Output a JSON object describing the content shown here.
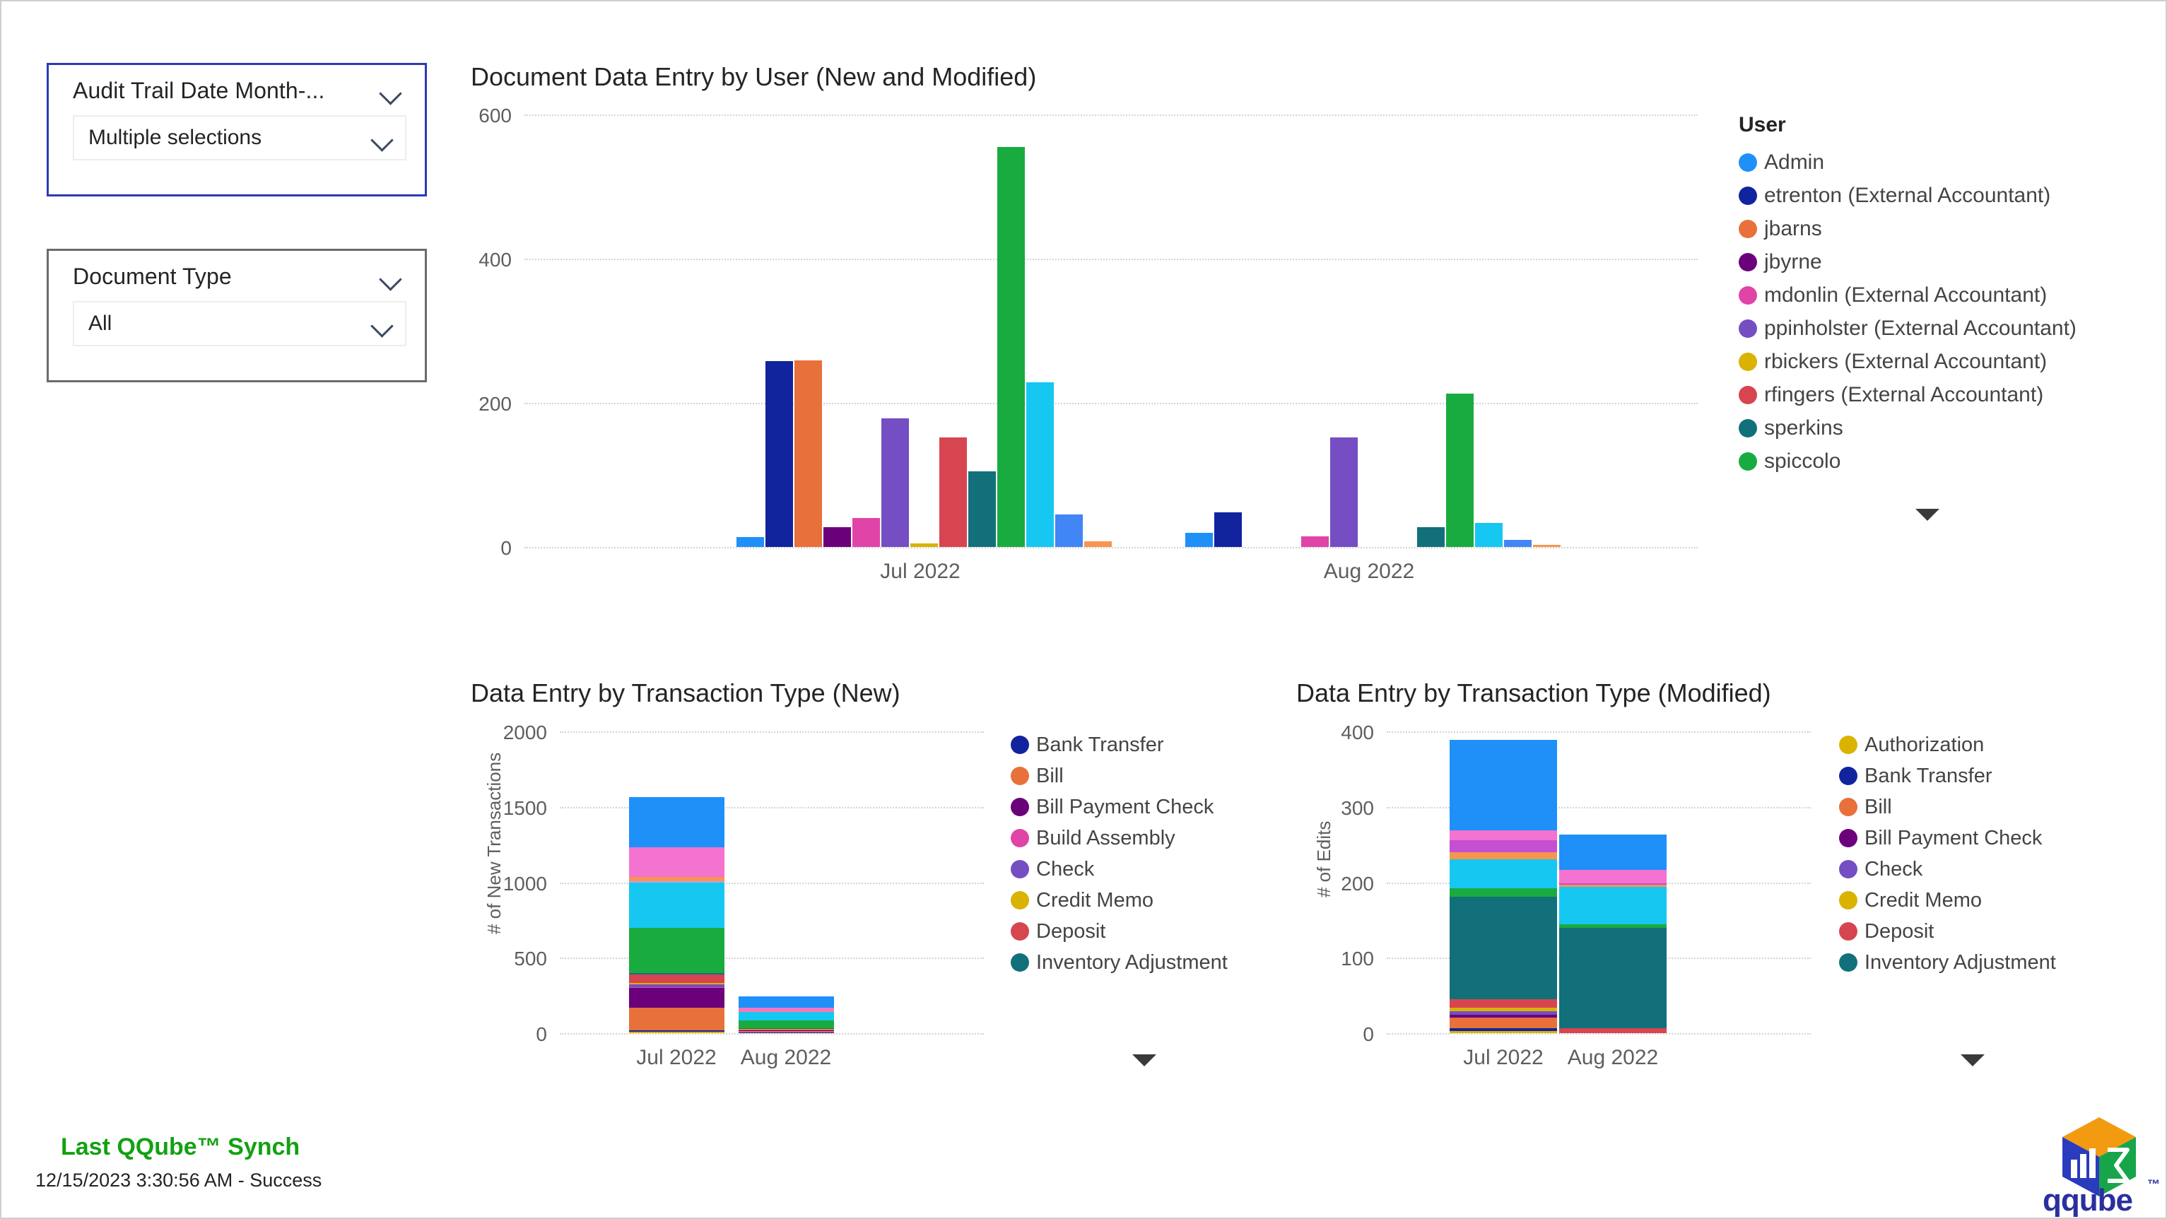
{
  "slicers": [
    {
      "title": "Audit Trail Date Month-...",
      "value": "Multiple selections",
      "chevron": "chevron-down-icon"
    },
    {
      "title": "Document Type",
      "value": "All",
      "chevron": "chevron-down-icon"
    }
  ],
  "footer": {
    "synch_title": "Last QQube™ Synch",
    "synch_status": "12/15/2023 3:30:56 AM - Success",
    "logo_word": "qqube",
    "logo_tm": "™"
  },
  "chart_data": [
    {
      "id": "document-data-entry-by-user",
      "type": "bar",
      "title": "Document Data Entry by User (New and Modified)",
      "xlabel": "",
      "ylabel": "",
      "ylim": [
        0,
        600
      ],
      "yticks": [
        0,
        200,
        400,
        600
      ],
      "grid": true,
      "legend_position": "right",
      "legend_title": "User",
      "categories": [
        "Jul 2022",
        "Aug 2022"
      ],
      "series": [
        {
          "name": "Admin",
          "color": "#1e90f8",
          "values": [
            14,
            20
          ]
        },
        {
          "name": "etrenton (External Accountant)",
          "color": "#12239e",
          "values": [
            258,
            48
          ]
        },
        {
          "name": "jbarns",
          "color": "#e8703a",
          "values": [
            259,
            0
          ]
        },
        {
          "name": "jbyrne",
          "color": "#6b007b",
          "values": [
            27,
            0
          ]
        },
        {
          "name": "mdonlin (External Accountant)",
          "color": "#e044a7",
          "values": [
            40,
            15
          ]
        },
        {
          "name": "ppinholster (External Accountant)",
          "color": "#744ec2",
          "values": [
            178,
            152
          ]
        },
        {
          "name": "rbickers (External Accountant)",
          "color": "#d9b300",
          "values": [
            5,
            0
          ]
        },
        {
          "name": "rfingers (External Accountant)",
          "color": "#d64550",
          "values": [
            152,
            0
          ]
        },
        {
          "name": "sperkins",
          "color": "#12707b",
          "values": [
            105,
            27
          ]
        },
        {
          "name": "spiccolo",
          "color": "#1aab40",
          "values": [
            555,
            213
          ]
        },
        {
          "name": "scrolled-1",
          "color": "#16c7f2",
          "values": [
            228,
            33
          ]
        },
        {
          "name": "scrolled-2",
          "color": "#4285f4",
          "values": [
            45,
            10
          ]
        },
        {
          "name": "scrolled-3",
          "color": "#f7954f",
          "values": [
            8,
            3
          ]
        }
      ],
      "legend_entries": [
        {
          "label": "Admin",
          "color": "#1e90f8"
        },
        {
          "label": "etrenton (External Accountant)",
          "color": "#12239e"
        },
        {
          "label": "jbarns",
          "color": "#e8703a"
        },
        {
          "label": "jbyrne",
          "color": "#6b007b"
        },
        {
          "label": "mdonlin (External Accountant)",
          "color": "#e044a7"
        },
        {
          "label": "ppinholster (External Accountant)",
          "color": "#744ec2"
        },
        {
          "label": "rbickers (External Accountant)",
          "color": "#d9b300"
        },
        {
          "label": "rfingers (External Accountant)",
          "color": "#d64550"
        },
        {
          "label": "sperkins",
          "color": "#12707b"
        },
        {
          "label": "spiccolo",
          "color": "#1aab40"
        }
      ]
    },
    {
      "id": "data-entry-by-transaction-type-new",
      "type": "bar",
      "stacked": true,
      "title": "Data Entry by Transaction Type (New)",
      "xlabel": "",
      "ylabel": "# of New Transactions",
      "ylim": [
        0,
        2000
      ],
      "yticks": [
        0,
        500,
        1000,
        1500,
        2000
      ],
      "grid": true,
      "legend_position": "right",
      "categories": [
        "Jul 2022",
        "Aug 2022"
      ],
      "series": [
        {
          "name": "Authorization",
          "color": "#d9b300",
          "values": [
            8,
            3
          ]
        },
        {
          "name": "Bank Transfer",
          "color": "#12239e",
          "values": [
            10,
            4
          ]
        },
        {
          "name": "Bill",
          "color": "#e8703a",
          "values": [
            150,
            10
          ]
        },
        {
          "name": "Bill Payment Check",
          "color": "#6b007b",
          "values": [
            130,
            4
          ]
        },
        {
          "name": "Build Assembly",
          "color": "#e044a7",
          "values": [
            6,
            2
          ]
        },
        {
          "name": "Check",
          "color": "#744ec2",
          "values": [
            18,
            3
          ]
        },
        {
          "name": "Credit Memo",
          "color": "#d9b300",
          "values": [
            10,
            2
          ]
        },
        {
          "name": "Deposit",
          "color": "#d64550",
          "values": [
            58,
            4
          ]
        },
        {
          "name": "Inventory Adjustment",
          "color": "#12707b",
          "values": [
            9,
            3
          ]
        },
        {
          "name": "scrolled-green",
          "color": "#1aab40",
          "values": [
            300,
            48
          ]
        },
        {
          "name": "scrolled-cyan",
          "color": "#16c7f2",
          "values": [
            300,
            58
          ]
        },
        {
          "name": "scrolled-lavender",
          "color": "#b9a0e8",
          "values": [
            8,
            2
          ]
        },
        {
          "name": "scrolled-orange",
          "color": "#f7954f",
          "values": [
            26,
            4
          ]
        },
        {
          "name": "scrolled-pink",
          "color": "#f472d0",
          "values": [
            200,
            20
          ]
        },
        {
          "name": "scrolled-blue",
          "color": "#1e90f8",
          "values": [
            330,
            75
          ]
        }
      ],
      "legend_entries": [
        {
          "label": "Bank Transfer",
          "color": "#12239e"
        },
        {
          "label": "Bill",
          "color": "#e8703a"
        },
        {
          "label": "Bill Payment Check",
          "color": "#6b007b"
        },
        {
          "label": "Build Assembly",
          "color": "#e044a7"
        },
        {
          "label": "Check",
          "color": "#744ec2"
        },
        {
          "label": "Credit Memo",
          "color": "#d9b300"
        },
        {
          "label": "Deposit",
          "color": "#d64550"
        },
        {
          "label": "Inventory Adjustment",
          "color": "#12707b"
        }
      ]
    },
    {
      "id": "data-entry-by-transaction-type-modified",
      "type": "bar",
      "stacked": true,
      "title": "Data Entry by Transaction Type (Modified)",
      "xlabel": "",
      "ylabel": "# of Edits",
      "ylim": [
        0,
        400
      ],
      "yticks": [
        0,
        100,
        200,
        300,
        400
      ],
      "grid": true,
      "legend_position": "right",
      "categories": [
        "Jul 2022",
        "Aug 2022"
      ],
      "series": [
        {
          "name": "Authorization",
          "color": "#d9b300",
          "values": [
            3,
            0
          ]
        },
        {
          "name": "Bank Transfer",
          "color": "#12239e",
          "values": [
            4,
            0
          ]
        },
        {
          "name": "Bill",
          "color": "#e8703a",
          "values": [
            14,
            0
          ]
        },
        {
          "name": "Bill Payment Check",
          "color": "#6b007b",
          "values": [
            3,
            0
          ]
        },
        {
          "name": "Check",
          "color": "#744ec2",
          "values": [
            5,
            0
          ]
        },
        {
          "name": "Credit Memo",
          "color": "#d9b300",
          "values": [
            5,
            0
          ]
        },
        {
          "name": "Deposit",
          "color": "#d64550",
          "values": [
            11,
            7
          ]
        },
        {
          "name": "Inventory Adjustment",
          "color": "#12707b",
          "values": [
            136,
            133
          ]
        },
        {
          "name": "scrolled-green",
          "color": "#1aab40",
          "values": [
            11,
            4
          ]
        },
        {
          "name": "scrolled-cyan",
          "color": "#16c7f2",
          "values": [
            38,
            50
          ]
        },
        {
          "name": "scrolled-orange",
          "color": "#f7954f",
          "values": [
            10,
            3
          ]
        },
        {
          "name": "scrolled-orchid",
          "color": "#c44fd1",
          "values": [
            16,
            2
          ]
        },
        {
          "name": "scrolled-pink",
          "color": "#f472d0",
          "values": [
            13,
            17
          ]
        },
        {
          "name": "scrolled-blue",
          "color": "#1e90f8",
          "values": [
            120,
            47
          ]
        }
      ],
      "legend_entries": [
        {
          "label": "Authorization",
          "color": "#d9b300"
        },
        {
          "label": "Bank Transfer",
          "color": "#12239e"
        },
        {
          "label": "Bill",
          "color": "#e8703a"
        },
        {
          "label": "Bill Payment Check",
          "color": "#6b007b"
        },
        {
          "label": "Check",
          "color": "#744ec2"
        },
        {
          "label": "Credit Memo",
          "color": "#d9b300"
        },
        {
          "label": "Deposit",
          "color": "#d64550"
        },
        {
          "label": "Inventory Adjustment",
          "color": "#12707b"
        }
      ]
    }
  ]
}
